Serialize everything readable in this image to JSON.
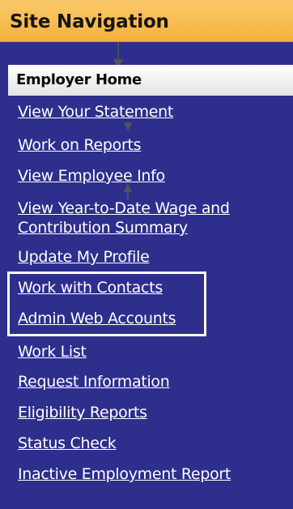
{
  "sidebar": {
    "title": "Site Navigation",
    "home_label": "Employer Home",
    "links": [
      "View Your Statement",
      "Work on Reports",
      "View Employee Info",
      "View Year-to-Date Wage and Contribution Summary",
      "Update My Profile",
      "Work with Contacts",
      "Admin Web Accounts",
      "Work List",
      "Request Information",
      "Eligibility Reports",
      "Status Check",
      "Inactive Employment Report"
    ]
  },
  "colors": {
    "background": "#2e2e8c",
    "header": "#f4b13e",
    "link": "#ffffff"
  }
}
